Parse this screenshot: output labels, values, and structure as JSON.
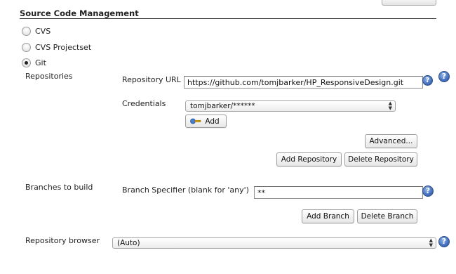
{
  "section": {
    "title": "Source Code Management"
  },
  "scm_options": [
    {
      "label": "CVS",
      "selected": false
    },
    {
      "label": "CVS Projectset",
      "selected": false
    },
    {
      "label": "Git",
      "selected": true
    }
  ],
  "repositories": {
    "label": "Repositories",
    "url_label": "Repository URL",
    "url_value": "https://github.com/tomjbarker/HP_ResponsiveDesign.git",
    "credentials_label": "Credentials",
    "credentials_value": "tomjbarker/******",
    "add_label": "Add",
    "advanced_label": "Advanced...",
    "add_repository_label": "Add Repository",
    "delete_repository_label": "Delete Repository"
  },
  "branches": {
    "label": "Branches to build",
    "specifier_label": "Branch Specifier (blank for 'any')",
    "specifier_value": "**",
    "add_branch_label": "Add Branch",
    "delete_branch_label": "Delete Branch"
  },
  "browser": {
    "label": "Repository browser",
    "value": "(Auto)"
  },
  "icons": {
    "help": "help-icon",
    "validator": "question-icon",
    "key": "key-icon",
    "select_arrows": "chevron-updown-icon"
  }
}
